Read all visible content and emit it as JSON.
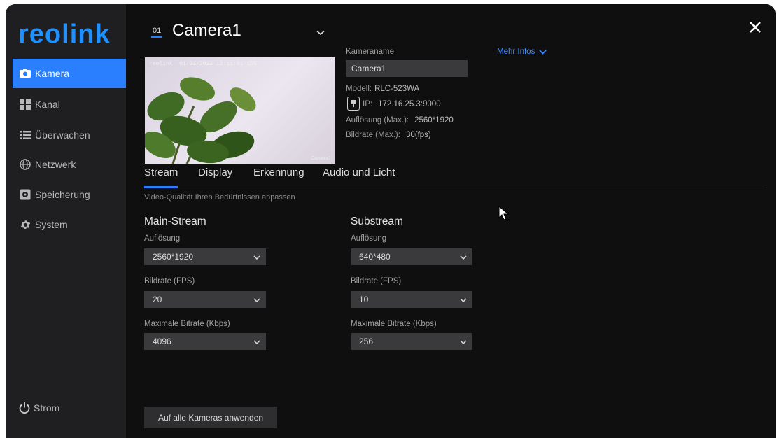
{
  "brand": {
    "logo_text": "reolink",
    "accent": "#2a7fff"
  },
  "sidebar": {
    "items": [
      {
        "label": "Kamera",
        "icon": "camera-icon",
        "active": true
      },
      {
        "label": "Kanal",
        "icon": "grid-icon",
        "active": false
      },
      {
        "label": "Überwachen",
        "icon": "list-icon",
        "active": false
      },
      {
        "label": "Netzwerk",
        "icon": "globe-icon",
        "active": false
      },
      {
        "label": "Speicherung",
        "icon": "storage-icon",
        "active": false
      },
      {
        "label": "System",
        "icon": "gear-icon",
        "active": false
      }
    ],
    "power_label": "Strom"
  },
  "header": {
    "channel_number": "01",
    "camera_title": "Camera1"
  },
  "preview": {
    "osd_logo": "reolink",
    "osd_timestamp": "01/01/2022 12:11:01 155",
    "osd_name": "Camera1"
  },
  "info": {
    "name_label": "Kameraname",
    "name_value": "Camera1",
    "model_label": "Modell:",
    "model_value": "RLC-523WA",
    "ip_label": "IP:",
    "ip_value": "172.16.25.3:9000",
    "res_label": "Auflösung (Max.):",
    "res_value": "2560*1920",
    "fps_label": "Bildrate (Max.):",
    "fps_value": "30(fps)",
    "more_label": "Mehr Infos"
  },
  "tabs": [
    "Stream",
    "Display",
    "Erkennung",
    "Audio und Licht"
  ],
  "hint": "Video-Qualität Ihren Bedürfnissen anpassen",
  "main_stream": {
    "title": "Main-Stream",
    "res_label": "Auflösung",
    "res_value": "2560*1920",
    "fps_label": "Bildrate (FPS)",
    "fps_value": "20",
    "bitrate_label": "Maximale Bitrate (Kbps)",
    "bitrate_value": "4096"
  },
  "sub_stream": {
    "title": "Substream",
    "res_label": "Auflösung",
    "res_value": "640*480",
    "fps_label": "Bildrate (FPS)",
    "fps_value": "10",
    "bitrate_label": "Maximale Bitrate (Kbps)",
    "bitrate_value": "256"
  },
  "apply_button": "Auf alle Kameras anwenden"
}
